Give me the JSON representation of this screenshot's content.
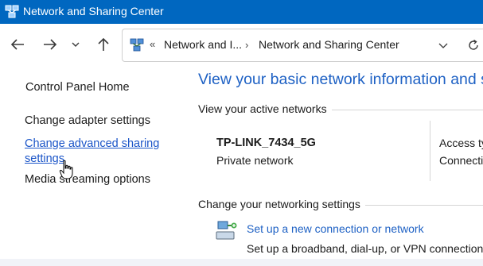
{
  "window": {
    "title": "Network and Sharing Center",
    "accent_color": "#0067c0",
    "link_color": "#1e61c4",
    "icon": "network-sharing-icon"
  },
  "nav": {
    "back_icon": "arrow-left-icon",
    "forward_icon": "arrow-right-icon",
    "recent_icon": "chevron-down-icon",
    "up_icon": "arrow-up-icon"
  },
  "address": {
    "overflow": "«",
    "crumbs": [
      "Network and I...",
      "Network and Sharing Center"
    ],
    "separator": "›",
    "dropdown_icon": "chevron-down-icon",
    "refresh_icon": "refresh-icon"
  },
  "sidebar": {
    "items": [
      {
        "label": "Control Panel Home"
      },
      {
        "label": "Change adapter settings"
      },
      {
        "label": "Change advanced sharing settings",
        "hovered": true
      },
      {
        "label": "Media streaming options"
      }
    ]
  },
  "main": {
    "heading": "View your basic network information and set",
    "active_section": "View your active networks",
    "network": {
      "name": "TP-LINK_7434_5G",
      "type": "Private network",
      "access_label": "Access ty",
      "connections_label": "Connectio"
    },
    "change_section": "Change your networking settings",
    "task": {
      "link": "Set up a new connection or network",
      "description": "Set up a broadband, dial-up, or VPN connection; o",
      "icon": "new-connection-icon"
    }
  }
}
